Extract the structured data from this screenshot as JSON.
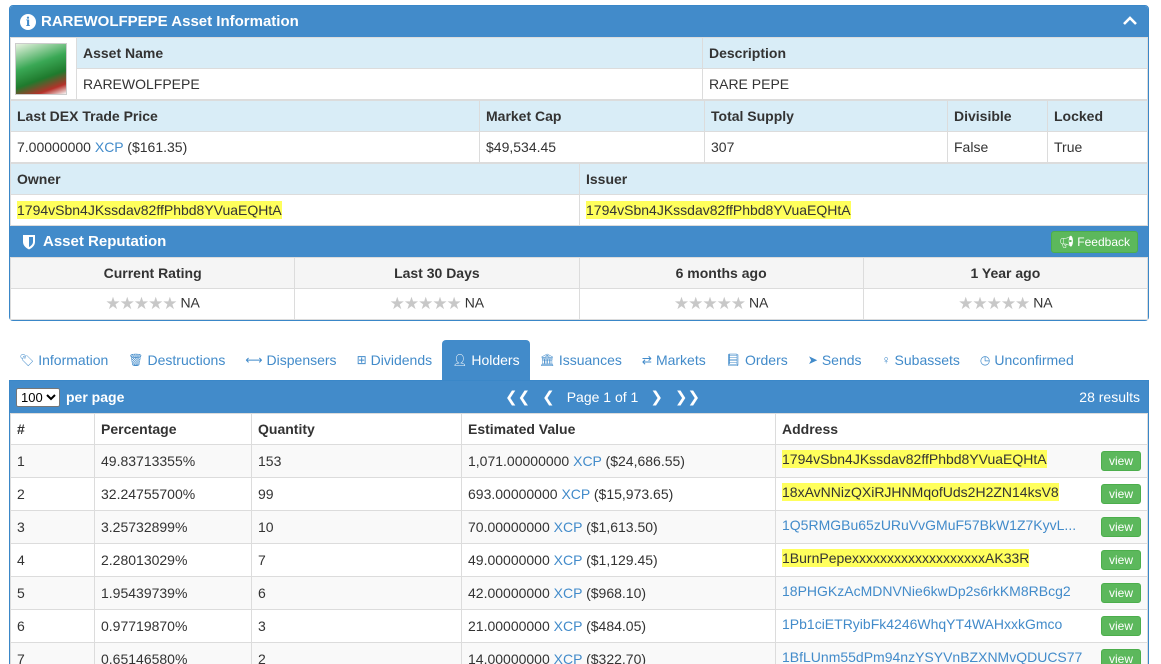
{
  "asset": {
    "title": "RAREWOLFPEPE Asset Information",
    "name_label": "Asset Name",
    "name_value": "RAREWOLFPEPE",
    "desc_label": "Description",
    "desc_value": "RARE PEPE",
    "price_label": "Last DEX Trade Price",
    "price_amount": "7.00000000",
    "price_unit": "XCP",
    "price_usd": "($161.35)",
    "mcap_label": "Market Cap",
    "mcap_value": "$49,534.45",
    "supply_label": "Total Supply",
    "supply_value": "307",
    "divisible_label": "Divisible",
    "divisible_value": "False",
    "locked_label": "Locked",
    "locked_value": "True",
    "owner_label": "Owner",
    "owner_value": "1794vSbn4JKssdav82ffPhbd8YVuaEQHtA",
    "issuer_label": "Issuer",
    "issuer_value": "1794vSbn4JKssdav82ffPhbd8YVuaEQHtA"
  },
  "reputation": {
    "title": "Asset Reputation",
    "feedback_label": "Feedback",
    "columns": [
      "Current Rating",
      "Last 30 Days",
      "6 months ago",
      "1 Year ago"
    ],
    "values": [
      "NA",
      "NA",
      "NA",
      "NA"
    ]
  },
  "tabs": [
    {
      "label": "Information",
      "icon": "tag-icon"
    },
    {
      "label": "Destructions",
      "icon": "trash-icon"
    },
    {
      "label": "Dispensers",
      "icon": "arrows-h-icon"
    },
    {
      "label": "Dividends",
      "icon": "sitemap-icon"
    },
    {
      "label": "Holders",
      "icon": "user-icon"
    },
    {
      "label": "Issuances",
      "icon": "bank-icon"
    },
    {
      "label": "Markets",
      "icon": "exchange-icon"
    },
    {
      "label": "Orders",
      "icon": "book-icon"
    },
    {
      "label": "Sends",
      "icon": "paper-plane-icon"
    },
    {
      "label": "Subassets",
      "icon": "child-icon"
    },
    {
      "label": "Unconfirmed",
      "icon": "clock-icon"
    }
  ],
  "holders": {
    "per_page_value": "100",
    "per_page_label": "per page",
    "page_info": "Page 1 of 1",
    "results": "28 results",
    "columns": [
      "#",
      "Percentage",
      "Quantity",
      "Estimated Value",
      "Address"
    ],
    "view_label": "view",
    "rows": [
      {
        "n": "1",
        "pct": "49.83713355%",
        "qty": "153",
        "amount": "1,071.00000000",
        "unit": "XCP",
        "usd": "($24,686.55)",
        "address": "1794vSbn4JKssdav82ffPhbd8YVuaEQHtA",
        "highlight": true
      },
      {
        "n": "2",
        "pct": "32.24755700%",
        "qty": "99",
        "amount": "693.00000000",
        "unit": "XCP",
        "usd": "($15,973.65)",
        "address": "18xAvNNizQXiRJHNMqofUds2H2ZN14ksV8",
        "highlight": true
      },
      {
        "n": "3",
        "pct": "3.25732899%",
        "qty": "10",
        "amount": "70.00000000",
        "unit": "XCP",
        "usd": "($1,613.50)",
        "address": "1Q5RMGBu65zURuVvGMuF57BkW1Z7KyvL...",
        "highlight": false
      },
      {
        "n": "4",
        "pct": "2.28013029%",
        "qty": "7",
        "amount": "49.00000000",
        "unit": "XCP",
        "usd": "($1,129.45)",
        "address": "1BurnPepexxxxxxxxxxxxxxxxxxxAK33R",
        "highlight": true
      },
      {
        "n": "5",
        "pct": "1.95439739%",
        "qty": "6",
        "amount": "42.00000000",
        "unit": "XCP",
        "usd": "($968.10)",
        "address": "18PHGKzAcMDNVNie6kwDp2s6rkKM8RBcg2",
        "highlight": false
      },
      {
        "n": "6",
        "pct": "0.97719870%",
        "qty": "3",
        "amount": "21.00000000",
        "unit": "XCP",
        "usd": "($484.05)",
        "address": "1Pb1ciETRyibFk4246WhqYT4WAHxxkGmco",
        "highlight": false
      },
      {
        "n": "7",
        "pct": "0.65146580%",
        "qty": "2",
        "amount": "14.00000000",
        "unit": "XCP",
        "usd": "($322.70)",
        "address": "1BfLUnm55dPm94nzYSYVnBZXNMvQDUCS77",
        "highlight": false
      }
    ]
  }
}
